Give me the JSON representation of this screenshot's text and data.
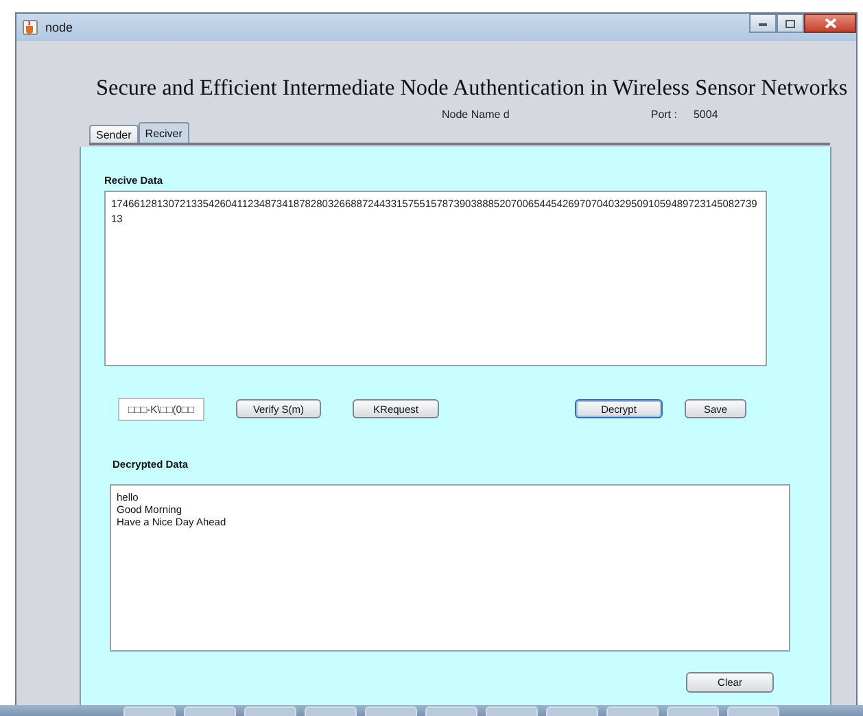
{
  "window": {
    "title": "node"
  },
  "heading": "Secure and Efficient Intermediate Node Authentication in Wireless Sensor Networks",
  "node_name": "Node Name d",
  "port_label": "Port :",
  "port": "5004",
  "tabs": [
    {
      "label": "Sender",
      "selected": false
    },
    {
      "label": "Reciver",
      "selected": true
    }
  ],
  "receive": {
    "label": "Recive Data",
    "text": "1746612813072133542604112348734187828032668872443315755157873903888520700654454269707040329509105948972314508273913"
  },
  "key_field": {
    "value": "□□□-K\\□□(0□□"
  },
  "buttons": [
    {
      "label": "Verify S(m)",
      "focused": false
    },
    {
      "label": "KRequest",
      "focused": false
    },
    {
      "label": "Decrypt",
      "focused": true
    },
    {
      "label": "Save",
      "focused": false
    }
  ],
  "decrypted": {
    "label": "Decrypted Data",
    "lines": [
      "hello",
      "Good Morning",
      "Have a Nice Day Ahead"
    ]
  },
  "clear_button": {
    "label": "Clear"
  }
}
